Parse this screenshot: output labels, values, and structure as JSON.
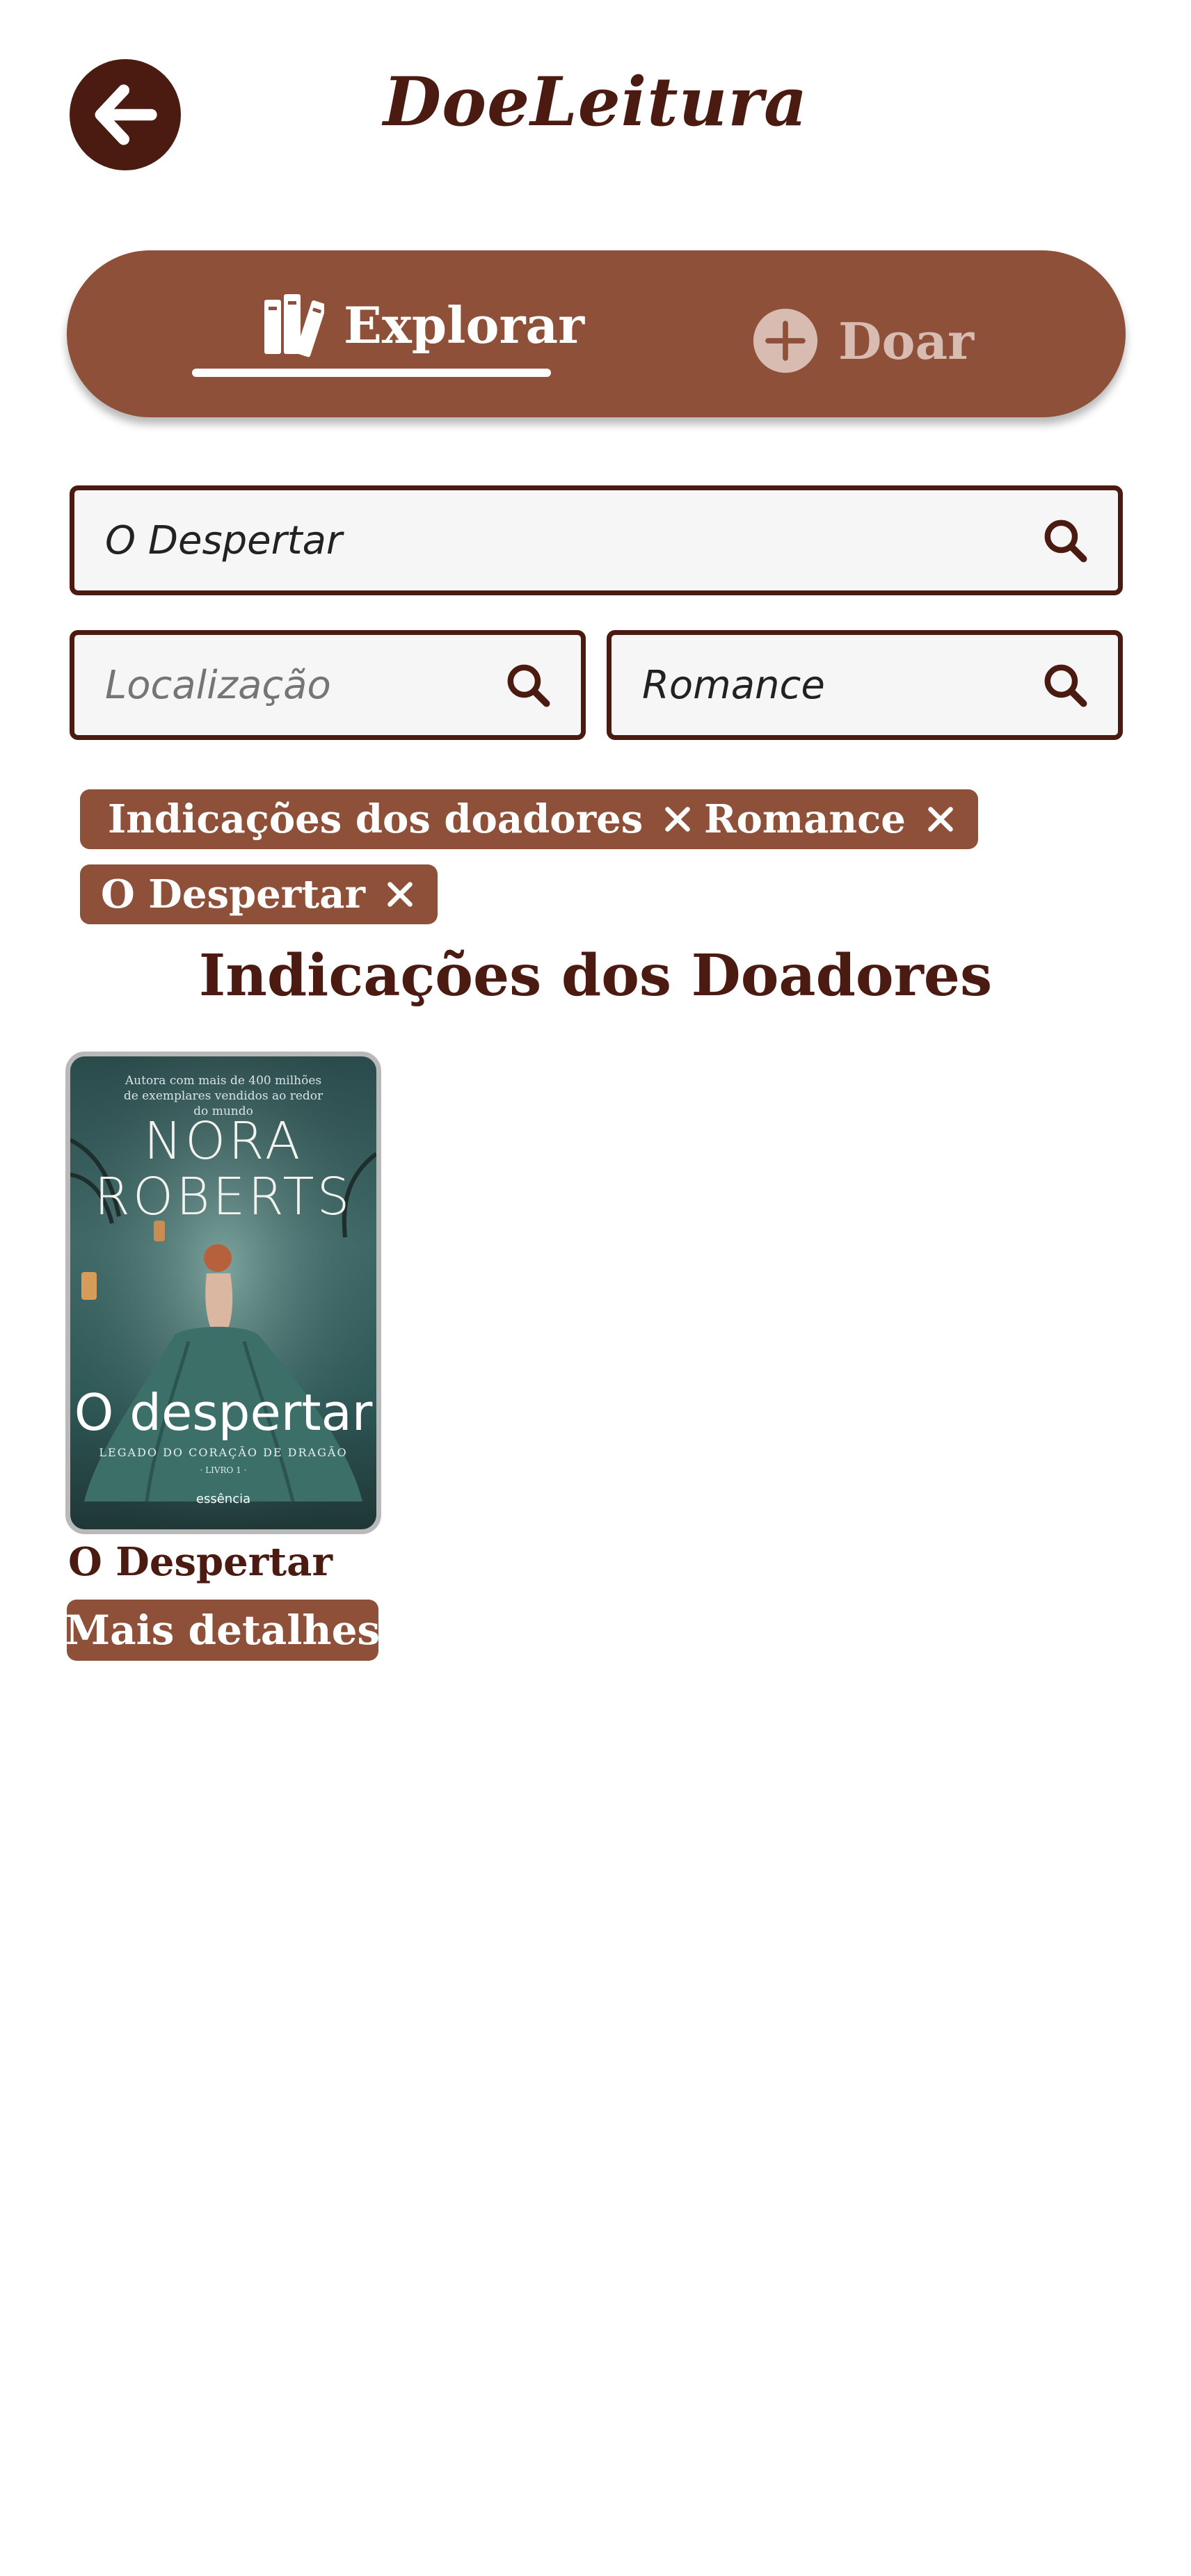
{
  "header": {
    "back_icon": "arrow-left-icon",
    "app_title": "DoeLeitura"
  },
  "tabs": [
    {
      "label": "Explorar",
      "icon": "books-icon",
      "active": true
    },
    {
      "label": "Doar",
      "icon": "plus-circle-icon",
      "active": false
    }
  ],
  "search": {
    "title_value": "O Despertar",
    "location_placeholder": "Localização",
    "genre_value": "Romance",
    "search_icon": "search-icon"
  },
  "filters": [
    {
      "label": "Indicações dos doadores",
      "remove_icon": "close-icon"
    },
    {
      "label": "Romance",
      "remove_icon": "close-icon"
    },
    {
      "label": "O Despertar",
      "remove_icon": "close-icon"
    }
  ],
  "section_title": "Indicações dos Doadores",
  "books": [
    {
      "title": "O Despertar",
      "details_label": "Mais detalhes",
      "cover": {
        "tagline": "Autora com mais de 400 milhões de exemplares vendidos ao redor do mundo",
        "author": "NORA ROBERTS",
        "title": "O despertar",
        "series": "LEGADO DO CORAÇÃO DE DRAGÃO",
        "book_number": "· LIVRO 1 ·",
        "publisher": "essência"
      }
    }
  ],
  "colors": {
    "primary": "#8e5039",
    "dark": "#4b1a10",
    "inactive_tab": "#d9bcb1",
    "field_bg": "#f6f6f6"
  }
}
